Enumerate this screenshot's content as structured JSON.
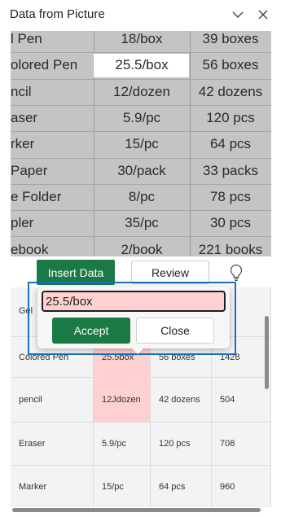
{
  "header": {
    "title": "Data from Picture",
    "icons": [
      "chevron-down-icon",
      "close-icon"
    ]
  },
  "picture": {
    "rows": [
      {
        "c1": "l Pen",
        "c2": "18/box",
        "c3": "39 boxes"
      },
      {
        "c1": "olored Pen",
        "c2": "25.5/box",
        "c3": "56 boxes"
      },
      {
        "c1": "ncil",
        "c2": "12/dozen",
        "c3": "42 dozens"
      },
      {
        "c1": "aser",
        "c2": "5.9/pc",
        "c3": "120 pcs"
      },
      {
        "c1": "rker",
        "c2": "15/pc",
        "c3": "64 pcs"
      },
      {
        "c1": " Paper",
        "c2": "30/pack",
        "c3": "33 packs"
      },
      {
        "c1": "e Folder",
        "c2": "8/pc",
        "c3": "78 pcs"
      },
      {
        "c1": "pler",
        "c2": "35/pc",
        "c3": "30 pcs"
      },
      {
        "c1": "ebook",
        "c2": "2/book",
        "c3": "221 books"
      }
    ]
  },
  "actions": {
    "insert_label": "Insert Data",
    "review_label": "Review",
    "hint_icon": "lightbulb-icon"
  },
  "table": {
    "rows": [
      {
        "c1": "Gel",
        "c2": "",
        "c3": "",
        "c4": "2",
        "err": false
      },
      {
        "c1": "Colored Pen",
        "c2": "25.5box",
        "c3": "56 boxes",
        "c4": "1428",
        "err": true
      },
      {
        "c1": "pencil",
        "c2": "12Jdozen",
        "c3": "42 dozens",
        "c4": "504",
        "err": true
      },
      {
        "c1": "Eraser",
        "c2": "5.9/pc",
        "c3": "120 pcs",
        "c4": "708",
        "err": false
      },
      {
        "c1": "Marker",
        "c2": "15/pc",
        "c3": "64 pcs",
        "c4": "960",
        "err": false
      }
    ]
  },
  "popup": {
    "input_value": "25.5/box",
    "accept_label": "Accept",
    "close_label": "Close"
  },
  "colors": {
    "accent_green": "#1b7a43",
    "error_fill": "#ffd0d0",
    "selection_blue": "#1a6fc0"
  }
}
